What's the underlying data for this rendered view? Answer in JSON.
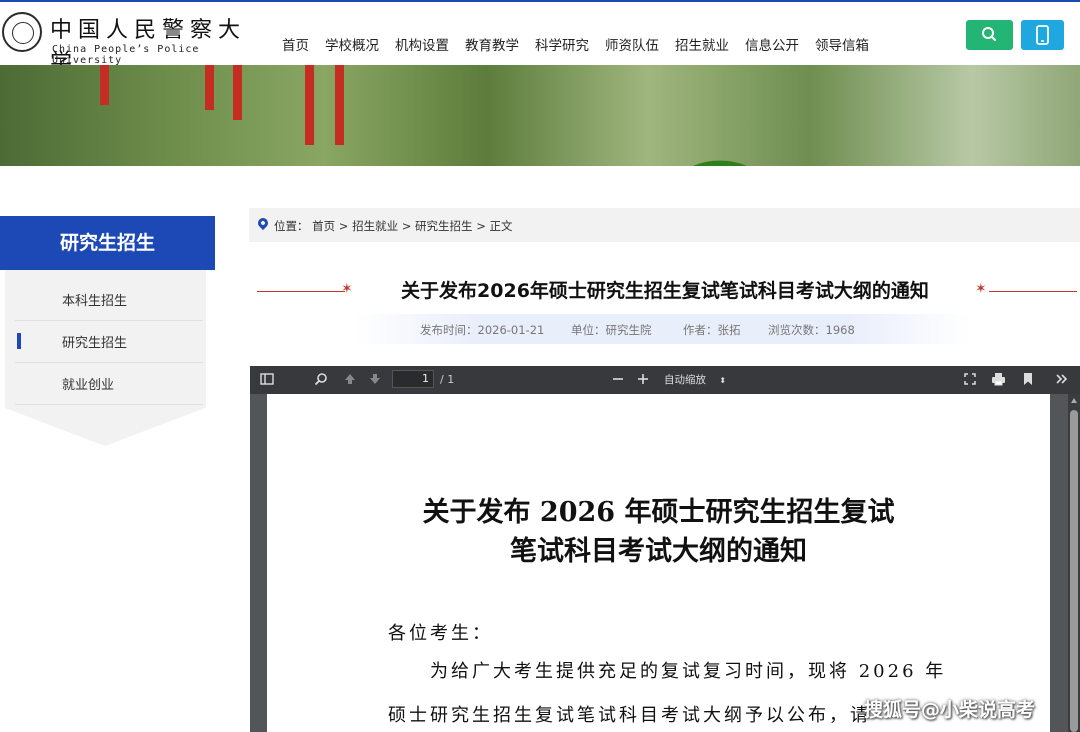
{
  "header": {
    "logo_cn": "中国人民警察大学",
    "logo_en": "China People’s Police University",
    "nav": [
      "首页",
      "学校概况",
      "机构设置",
      "教育教学",
      "科学研究",
      "师资队伍",
      "招生就业",
      "信息公开",
      "领导信箱"
    ],
    "colors": {
      "search_button": "#22b573",
      "mobile_button": "#20a7e0",
      "brand_blue": "#1d49b6"
    }
  },
  "sidebar": {
    "title": "研究生招生",
    "items": [
      {
        "label": "本科生招生",
        "active": false
      },
      {
        "label": "研究生招生",
        "active": true
      },
      {
        "label": "就业创业",
        "active": false
      }
    ]
  },
  "breadcrumb": {
    "prefix": "位置：",
    "path": "首页 > 招生就业 > 研究生招生 > 正文"
  },
  "article": {
    "title": "关于发布2026年硕士研究生招生复试笔试科目考试大纲的通知",
    "publish_time": "发布时间：2026-01-21",
    "unit": "单位：研究生院",
    "author": "作者：张拓",
    "views": "浏览次数：1968"
  },
  "pdf_viewer": {
    "page_current": "1",
    "page_total": "/ 1",
    "zoom": "自动缩放",
    "doc_title_line1": "关于发布 2026 年硕士研究生招生复试",
    "doc_title_line2": "笔试科目考试大纲的通知",
    "salutation": "各位考生：",
    "para_line1": "为给广大考生提供充足的复试复习时间，现将 2026 年",
    "para_line2": "硕士研究生招生复试笔试科目考试大纲予以公布，请"
  },
  "watermark": "搜狐号@小柴说高考"
}
